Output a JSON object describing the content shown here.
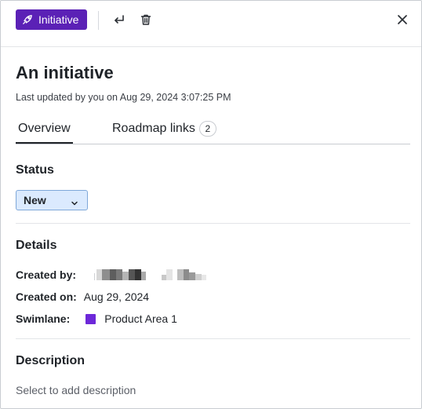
{
  "header": {
    "type_label": "Initiative",
    "type_icon": "rocket-icon",
    "actions": [
      {
        "name": "return-icon"
      },
      {
        "name": "trash-icon"
      }
    ],
    "close_icon": "close-icon",
    "accent": "#5b21b6"
  },
  "item": {
    "title": "An initiative",
    "last_updated": "Last updated by you on Aug 29, 2024 3:07:25 PM"
  },
  "tabs": [
    {
      "label": "Overview",
      "active": true
    },
    {
      "label": "Roadmap links",
      "count": "2",
      "active": false
    }
  ],
  "status": {
    "heading": "Status",
    "value": "New",
    "select_bg": "#dbeafe"
  },
  "details": {
    "heading": "Details",
    "created_by_label": "Created by:",
    "created_on_label": "Created on:",
    "created_on_value": "Aug 29, 2024",
    "swimlane_label": "Swimlane:",
    "swimlane_value": "Product Area 1",
    "swimlane_color": "#6d28d9"
  },
  "description": {
    "heading": "Description",
    "placeholder": "Select to add description"
  }
}
